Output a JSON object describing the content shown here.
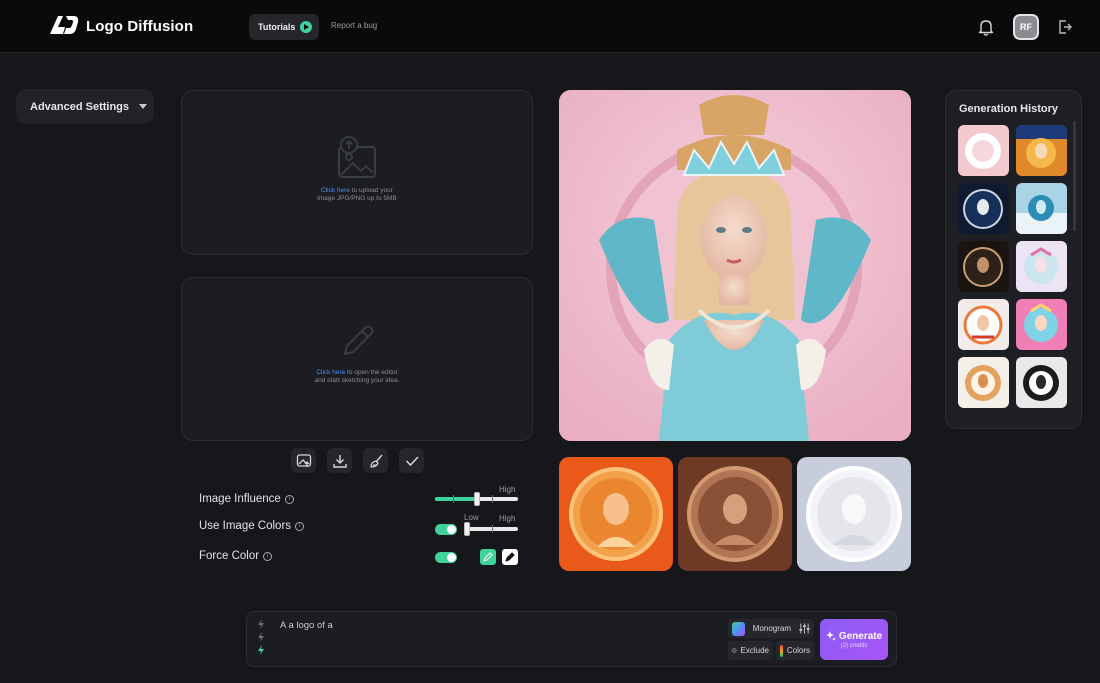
{
  "header": {
    "app_name": "Logo Diffusion",
    "tutorials_label": "Tutorials",
    "report_bug_label": "Report a bug",
    "avatar_initials": "RF"
  },
  "settings": {
    "advanced_label": "Advanced Settings",
    "image_influence_label": "Image Influence",
    "image_influence_high": "High",
    "use_image_colors_label": "Use Image Colors",
    "use_image_colors_low": "Low",
    "use_image_colors_high": "High",
    "force_color_label": "Force Color"
  },
  "upload": {
    "link": "Click here",
    "text_rest": " to upload your",
    "text_line2": "image JPG/PNG up to 5MB"
  },
  "sketch": {
    "link": "Click here",
    "text_rest": " to open the editor",
    "text_line2": "and start sketching your idea."
  },
  "history": {
    "title": "Generation History"
  },
  "prompt": {
    "text": "A a logo of a",
    "style_label": "Monogram",
    "exclude_label": "Exclude",
    "colors_label": "Colors",
    "generate_label": "Generate",
    "credits_label": "(2) credits"
  },
  "colors": {
    "accent_green": "#3fd39b",
    "accent_purple": "#8b5cf6",
    "link_blue": "#4f8ef7"
  }
}
